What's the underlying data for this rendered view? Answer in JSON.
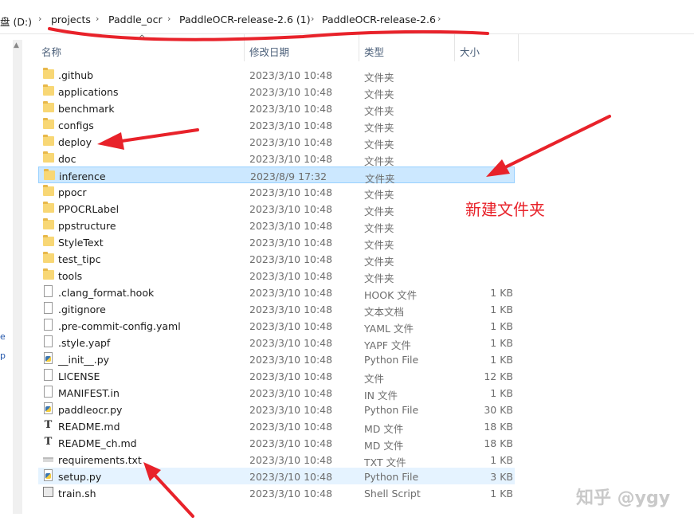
{
  "breadcrumb": {
    "items": [
      "盘 (D:)",
      "projects",
      "Paddle_ocr",
      "PaddleOCR-release-2.6 (1)",
      "PaddleOCR-release-2.6"
    ]
  },
  "columns": {
    "name": "名称",
    "date": "修改日期",
    "type": "类型",
    "size": "大小"
  },
  "files": [
    {
      "name": ".github",
      "date": "2023/3/10 10:48",
      "type": "文件夹",
      "size": "",
      "icon": "folder-icon"
    },
    {
      "name": "applications",
      "date": "2023/3/10 10:48",
      "type": "文件夹",
      "size": "",
      "icon": "folder-icon"
    },
    {
      "name": "benchmark",
      "date": "2023/3/10 10:48",
      "type": "文件夹",
      "size": "",
      "icon": "folder-icon"
    },
    {
      "name": "configs",
      "date": "2023/3/10 10:48",
      "type": "文件夹",
      "size": "",
      "icon": "folder-icon"
    },
    {
      "name": "deploy",
      "date": "2023/3/10 10:48",
      "type": "文件夹",
      "size": "",
      "icon": "folder-icon"
    },
    {
      "name": "doc",
      "date": "2023/3/10 10:48",
      "type": "文件夹",
      "size": "",
      "icon": "folder-icon"
    },
    {
      "name": "inference",
      "date": "2023/8/9 17:32",
      "type": "文件夹",
      "size": "",
      "icon": "folder-icon",
      "selected": true
    },
    {
      "name": "ppocr",
      "date": "2023/3/10 10:48",
      "type": "文件夹",
      "size": "",
      "icon": "folder-icon"
    },
    {
      "name": "PPOCRLabel",
      "date": "2023/3/10 10:48",
      "type": "文件夹",
      "size": "",
      "icon": "folder-icon"
    },
    {
      "name": "ppstructure",
      "date": "2023/3/10 10:48",
      "type": "文件夹",
      "size": "",
      "icon": "folder-icon"
    },
    {
      "name": "StyleText",
      "date": "2023/3/10 10:48",
      "type": "文件夹",
      "size": "",
      "icon": "folder-icon"
    },
    {
      "name": "test_tipc",
      "date": "2023/3/10 10:48",
      "type": "文件夹",
      "size": "",
      "icon": "folder-icon"
    },
    {
      "name": "tools",
      "date": "2023/3/10 10:48",
      "type": "文件夹",
      "size": "",
      "icon": "folder-icon"
    },
    {
      "name": ".clang_format.hook",
      "date": "2023/3/10 10:48",
      "type": "HOOK 文件",
      "size": "1 KB",
      "icon": "file-icon"
    },
    {
      "name": ".gitignore",
      "date": "2023/3/10 10:48",
      "type": "文本文档",
      "size": "1 KB",
      "icon": "file-icon"
    },
    {
      "name": ".pre-commit-config.yaml",
      "date": "2023/3/10 10:48",
      "type": "YAML 文件",
      "size": "1 KB",
      "icon": "file-icon"
    },
    {
      "name": ".style.yapf",
      "date": "2023/3/10 10:48",
      "type": "YAPF 文件",
      "size": "1 KB",
      "icon": "file-icon"
    },
    {
      "name": "__init__.py",
      "date": "2023/3/10 10:48",
      "type": "Python File",
      "size": "1 KB",
      "icon": "python-file-icon"
    },
    {
      "name": "LICENSE",
      "date": "2023/3/10 10:48",
      "type": "文件",
      "size": "12 KB",
      "icon": "file-icon"
    },
    {
      "name": "MANIFEST.in",
      "date": "2023/3/10 10:48",
      "type": "IN 文件",
      "size": "1 KB",
      "icon": "file-icon"
    },
    {
      "name": "paddleocr.py",
      "date": "2023/3/10 10:48",
      "type": "Python File",
      "size": "30 KB",
      "icon": "python-file-icon"
    },
    {
      "name": "README.md",
      "date": "2023/3/10 10:48",
      "type": "MD 文件",
      "size": "18 KB",
      "icon": "markdown-file-icon"
    },
    {
      "name": "README_ch.md",
      "date": "2023/3/10 10:48",
      "type": "MD 文件",
      "size": "18 KB",
      "icon": "markdown-file-icon"
    },
    {
      "name": "requirements.txt",
      "date": "2023/3/10 10:48",
      "type": "TXT 文件",
      "size": "1 KB",
      "icon": "text-file-icon"
    },
    {
      "name": "setup.py",
      "date": "2023/3/10 10:48",
      "type": "Python File",
      "size": "3 KB",
      "icon": "python-file-icon",
      "hovered": true
    },
    {
      "name": "train.sh",
      "date": "2023/3/10 10:48",
      "type": "Shell Script",
      "size": "1 KB",
      "icon": "shell-script-icon"
    }
  ],
  "annotation": {
    "label": "新建文件夹",
    "color": "#e8222a"
  },
  "watermark": "知乎 @ygy",
  "left_pane_glyphs": [
    "e",
    "p"
  ]
}
